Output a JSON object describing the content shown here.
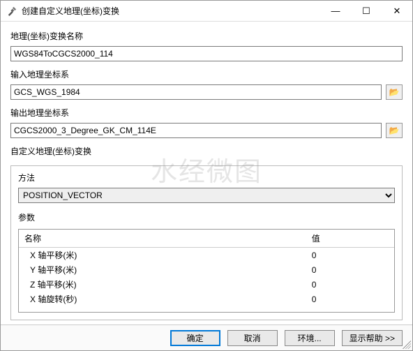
{
  "window": {
    "title": "创建自定义地理(坐标)变换"
  },
  "sys": {
    "minimize": "—",
    "maximize": "☐",
    "close": "✕"
  },
  "fields": {
    "transform_name_label": "地理(坐标)变换名称",
    "transform_name_value": "WGS84ToCGCS2000_114",
    "input_gcs_label": "输入地理坐标系",
    "input_gcs_value": "GCS_WGS_1984",
    "output_gcs_label": "输出地理坐标系",
    "output_gcs_value": "CGCS2000_3_Degree_GK_CM_114E",
    "custom_label": "自定义地理(坐标)变换"
  },
  "method": {
    "label": "方法",
    "value": "POSITION_VECTOR"
  },
  "params": {
    "label": "参数",
    "header_name": "名称",
    "header_value": "值",
    "rows": [
      {
        "name": "X 轴平移(米)",
        "value": "0"
      },
      {
        "name": "Y 轴平移(米)",
        "value": "0"
      },
      {
        "name": "Z 轴平移(米)",
        "value": "0"
      },
      {
        "name": "X 轴旋转(秒)",
        "value": "0"
      }
    ]
  },
  "buttons": {
    "ok": "确定",
    "cancel": "取消",
    "env": "环境...",
    "help": "显示帮助 >>"
  },
  "watermark": "水经微图",
  "icons": {
    "folder": "📂"
  }
}
